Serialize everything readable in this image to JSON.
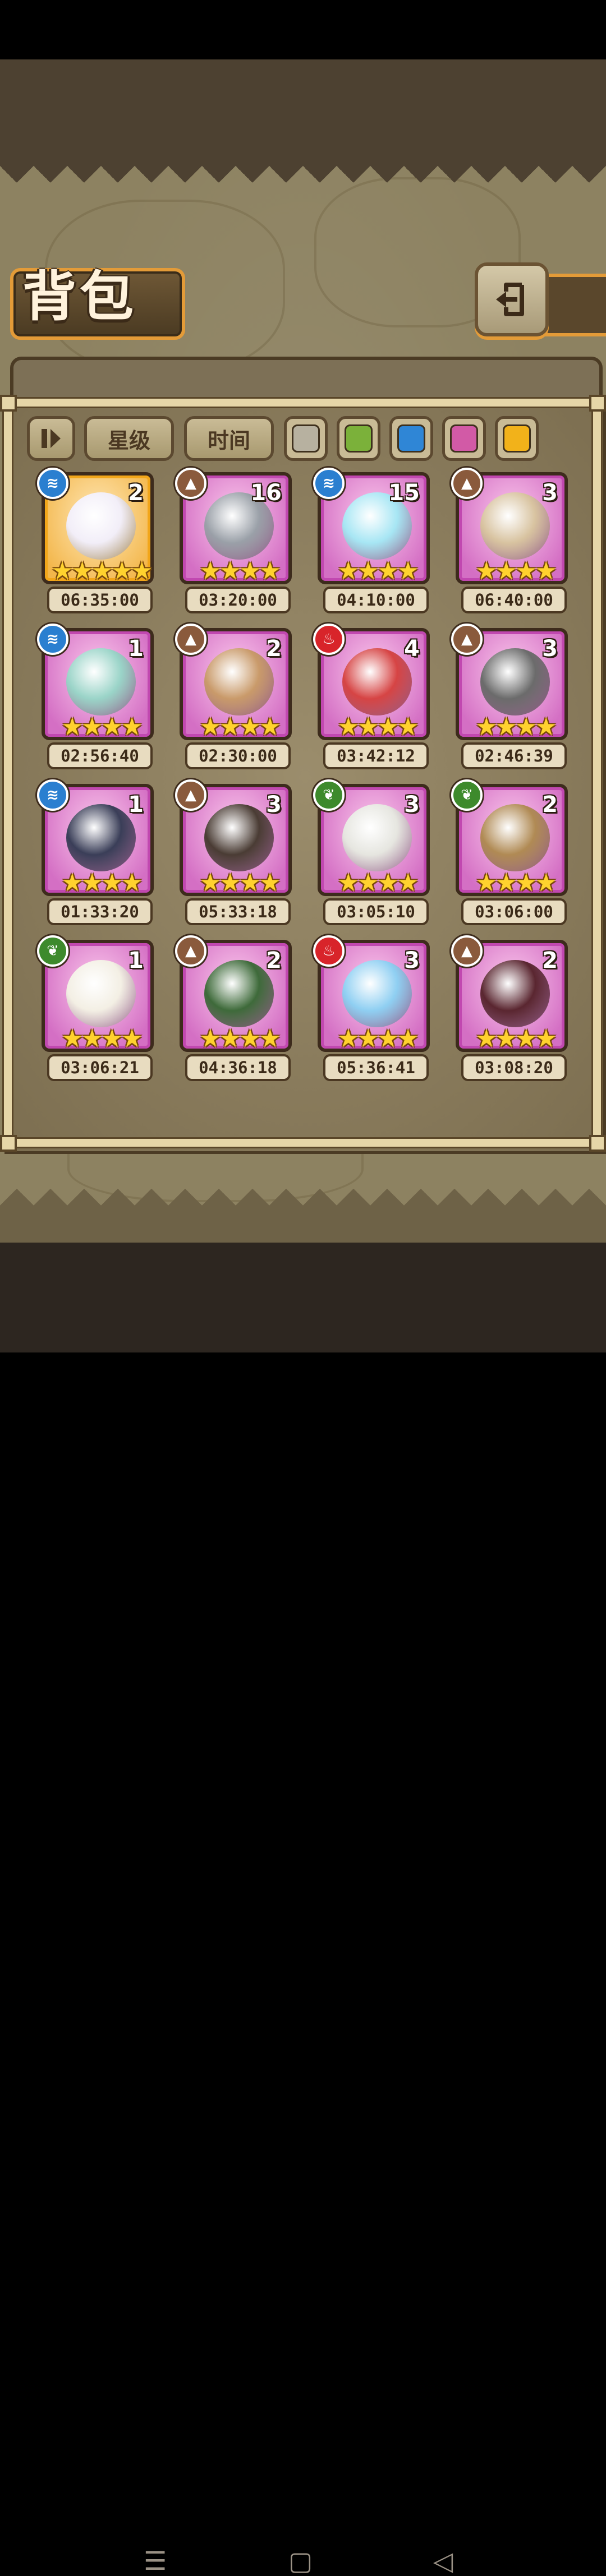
{
  "header": {
    "title": "背包"
  },
  "filters": {
    "sort_buttons": [
      "星级",
      "时间"
    ],
    "rarity_swatches": [
      {
        "name": "gray",
        "color": "#b7b1a0"
      },
      {
        "name": "green",
        "color": "#7bb13a"
      },
      {
        "name": "blue",
        "color": "#2f86d6"
      },
      {
        "name": "pink",
        "color": "#d25aa6"
      },
      {
        "name": "gold",
        "color": "#f2b21a"
      }
    ]
  },
  "items": [
    {
      "element": "water",
      "count": "2",
      "stars": "★★★★★",
      "timer": "06:35:00",
      "rarity": "gold"
    },
    {
      "element": "earth",
      "count": "16",
      "stars": "★★★★",
      "timer": "03:20:00",
      "rarity": "pink"
    },
    {
      "element": "water",
      "count": "15",
      "stars": "★★★★",
      "timer": "04:10:00",
      "rarity": "pink"
    },
    {
      "element": "earth",
      "count": "3",
      "stars": "★★★★",
      "timer": "06:40:00",
      "rarity": "pink"
    },
    {
      "element": "water",
      "count": "1",
      "stars": "★★★★",
      "timer": "02:56:40",
      "rarity": "pink"
    },
    {
      "element": "earth",
      "count": "2",
      "stars": "★★★★",
      "timer": "02:30:00",
      "rarity": "pink"
    },
    {
      "element": "fire",
      "count": "4",
      "stars": "★★★★",
      "timer": "03:42:12",
      "rarity": "pink"
    },
    {
      "element": "earth",
      "count": "3",
      "stars": "★★★★",
      "timer": "02:46:39",
      "rarity": "pink"
    },
    {
      "element": "water",
      "count": "1",
      "stars": "★★★★",
      "timer": "01:33:20",
      "rarity": "pink"
    },
    {
      "element": "earth",
      "count": "3",
      "stars": "★★★★",
      "timer": "05:33:18",
      "rarity": "pink"
    },
    {
      "element": "wood",
      "count": "3",
      "stars": "★★★★",
      "timer": "03:05:10",
      "rarity": "pink"
    },
    {
      "element": "wood",
      "count": "2",
      "stars": "★★★★",
      "timer": "03:06:00",
      "rarity": "pink"
    },
    {
      "element": "wood",
      "count": "1",
      "stars": "★★★★",
      "timer": "03:06:21",
      "rarity": "pink"
    },
    {
      "element": "earth",
      "count": "2",
      "stars": "★★★★",
      "timer": "04:36:18",
      "rarity": "pink"
    },
    {
      "element": "fire",
      "count": "3",
      "stars": "★★★★",
      "timer": "05:36:41",
      "rarity": "pink"
    },
    {
      "element": "earth",
      "count": "2",
      "stars": "★★★★",
      "timer": "03:08:20",
      "rarity": "pink"
    }
  ],
  "element_colors": {
    "water": "#2a7fd0",
    "earth": "#8a5a3c",
    "fire": "#d8242a",
    "wood": "#3d8a2c"
  },
  "art_colors": [
    "#f2eef8",
    "#9aa0a8",
    "#a7e6f4",
    "#d8c3a0",
    "#9ad4c8",
    "#c99a6a",
    "#d64444",
    "#6b6b6b",
    "#3a3e58",
    "#4a3c34",
    "#e6e6e0",
    "#b08a54",
    "#f3efe4",
    "#3e6a3a",
    "#8fcff2",
    "#5a2630"
  ]
}
